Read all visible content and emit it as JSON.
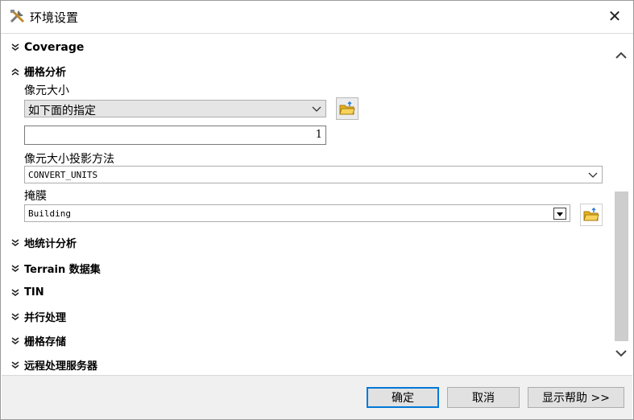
{
  "window": {
    "title": "环境设置",
    "close_glyph": "✕"
  },
  "sections": {
    "coverage": "Coverage",
    "raster_analysis": "栅格分析",
    "geostat": "地统计分析",
    "terrain": "Terrain 数据集",
    "tin": "TIN",
    "parallel": "并行处理",
    "raster_storage": "栅格存储",
    "remote": "远程处理服务器"
  },
  "raster_analysis": {
    "cell_size_label": "像元大小",
    "cell_size_option": "如下面的指定",
    "cell_size_value": "1",
    "projection_method_label": "像元大小投影方法",
    "projection_method_value": "CONVERT_UNITS",
    "mask_label": "掩膜",
    "mask_value": "Building"
  },
  "buttons": {
    "ok": "确定",
    "cancel": "取消",
    "help": "显示帮助 >>"
  },
  "icons": {
    "title": "tools-icon",
    "folder": "open-folder-icon",
    "expand": "double-chevron-down-icon",
    "collapse": "double-chevron-up-icon"
  },
  "colors": {
    "accent": "#0078d7",
    "folder": "#e8b21c"
  }
}
